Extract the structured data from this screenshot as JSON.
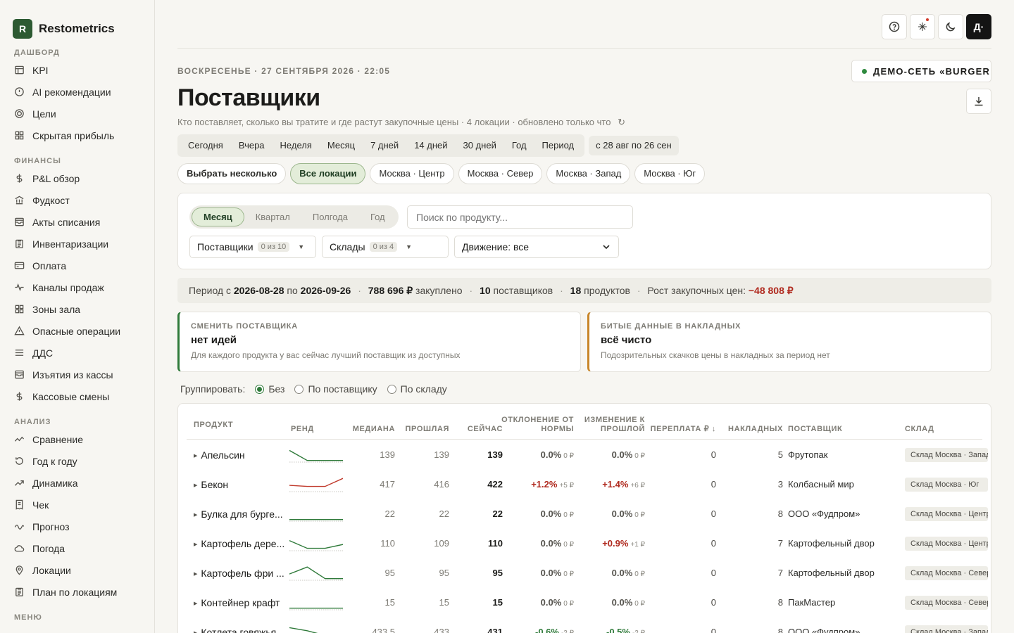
{
  "brand": {
    "logo_letter": "R",
    "name": "Restometrics"
  },
  "sidebar": {
    "sections": [
      {
        "title": "ДАШБОРД",
        "items": [
          {
            "label": "KPI",
            "icon": "layout-icon"
          },
          {
            "label": "AI рекомендации",
            "icon": "alert-circle-icon"
          },
          {
            "label": "Цели",
            "icon": "target-icon"
          },
          {
            "label": "Скрытая прибыль",
            "icon": "grid-icon"
          }
        ]
      },
      {
        "title": "ФИНАНСЫ",
        "items": [
          {
            "label": "P&L обзор",
            "icon": "dollar-icon"
          },
          {
            "label": "Фудкост",
            "icon": "bank-icon"
          },
          {
            "label": "Акты списания",
            "icon": "tray-icon"
          },
          {
            "label": "Инвентаризации",
            "icon": "clipboard-icon"
          },
          {
            "label": "Оплата",
            "icon": "card-icon"
          },
          {
            "label": "Каналы продаж",
            "icon": "pulse-icon"
          },
          {
            "label": "Зоны зала",
            "icon": "grid-icon"
          },
          {
            "label": "Опасные операции",
            "icon": "warning-icon"
          },
          {
            "label": "ДДС",
            "icon": "lines-icon"
          },
          {
            "label": "Изъятия из кассы",
            "icon": "tray-icon"
          },
          {
            "label": "Кассовые смены",
            "icon": "dollar-icon"
          }
        ]
      },
      {
        "title": "АНАЛИЗ",
        "items": [
          {
            "label": "Сравнение",
            "icon": "compare-icon"
          },
          {
            "label": "Год к году",
            "icon": "history-icon"
          },
          {
            "label": "Динамика",
            "icon": "trend-icon"
          },
          {
            "label": "Чек",
            "icon": "receipt-icon"
          },
          {
            "label": "Прогноз",
            "icon": "wave-icon"
          },
          {
            "label": "Погода",
            "icon": "cloud-icon"
          },
          {
            "label": "Локации",
            "icon": "pin-icon"
          },
          {
            "label": "План по локациям",
            "icon": "clipboard-icon"
          }
        ]
      },
      {
        "title": "МЕНЮ",
        "items": []
      }
    ]
  },
  "header": {
    "datetime": "ВОСКРЕСЕНЬЕ · 27 СЕНТЯБРЯ 2026 · 22:05",
    "org": "ДЕМО-СЕТЬ «BURGER...",
    "title": "Поставщики",
    "subtitle": "Кто поставляет, сколько вы тратите и где растут закупочные цены · 4 локации · обновлено только что",
    "refresh_glyph": "↻",
    "avatar_label": "Д·"
  },
  "period_tabs": [
    "Сегодня",
    "Вчера",
    "Неделя",
    "Месяц",
    "7 дней",
    "14 дней",
    "30 дней",
    "Год",
    "Период"
  ],
  "period_range": "с 28 авг по 26 сен",
  "locations": {
    "multi_label": "Выбрать несколько",
    "items": [
      "Все локации",
      "Москва · Центр",
      "Москва · Север",
      "Москва · Запад",
      "Москва · Юг"
    ],
    "active": "Все локации"
  },
  "filters": {
    "granularity": [
      "Месяц",
      "Квартал",
      "Полгода",
      "Год"
    ],
    "granularity_active": "Месяц",
    "search_placeholder": "Поиск по продукту...",
    "suppliers_label": "Поставщики",
    "suppliers_count": "0 из 10",
    "warehouses_label": "Склады",
    "warehouses_count": "0 из 4",
    "movement_label": "Движение: все"
  },
  "summary": {
    "period_prefix": "Период с",
    "date_from": "2026-08-28",
    "date_to_prefix": "по",
    "date_to": "2026-09-26",
    "purchased_value": "788 696 ₽",
    "purchased_label": "закуплено",
    "suppliers_value": "10",
    "suppliers_label": "поставщиков",
    "products_value": "18",
    "products_label": "продуктов",
    "price_growth_label": "Рост закупочных цен:",
    "price_growth_value": "−48 808 ₽"
  },
  "alerts": [
    {
      "title": "СМЕНИТЬ ПОСТАВЩИКА",
      "head": "нет идей",
      "text": "Для каждого продукта у вас сейчас лучший поставщик из доступных",
      "color": "#2f7a3a"
    },
    {
      "title": "БИТЫЕ ДАННЫЕ В НАКЛАДНЫХ",
      "head": "всё чисто",
      "text": "Подозрительных скачков цены в накладных за период нет",
      "color": "#c8862a"
    }
  ],
  "grouping": {
    "label": "Группировать:",
    "options": [
      "Без",
      "По поставщику",
      "По складу"
    ],
    "selected": "Без"
  },
  "table": {
    "columns": {
      "product": "ПРОДУКТ",
      "trend": "РЕНД",
      "median": "МЕДИАНА",
      "previous": "ПРОШЛАЯ",
      "current": "СЕЙЧАС",
      "deviation_l1": "ОТКЛОНЕНИЕ ОТ",
      "deviation_l2": "НОРМЫ",
      "change_l1": "ИЗМЕНЕНИЕ К",
      "change_l2": "ПРОШЛОЙ",
      "overpay": "ПЕРЕПЛАТА ₽ ↓",
      "invoices": "НАКЛАДНЫХ",
      "supplier": "ПОСТАВЩИК",
      "warehouse": "СКЛАД"
    },
    "rows": [
      {
        "product": "Апельсин",
        "median": "139",
        "previous": "139",
        "current": "139",
        "dev_pct": "0.0%",
        "dev_rub": "0 ₽",
        "dev_dir": "zero",
        "chg_pct": "0.0%",
        "chg_rub": "0 ₽",
        "chg_dir": "zero",
        "overpay": "0",
        "invoices": "5",
        "supplier": "Фрутопак",
        "warehouse": "Склад Москва · Запад",
        "trend": [
          0.2,
          0.85,
          0.85,
          0.85
        ],
        "trend_color": "#2f7a3a"
      },
      {
        "product": "Бекон",
        "median": "417",
        "previous": "416",
        "current": "422",
        "dev_pct": "+1.2%",
        "dev_rub": "+5 ₽",
        "dev_dir": "up",
        "chg_pct": "+1.4%",
        "chg_rub": "+6 ₽",
        "chg_dir": "up",
        "overpay": "0",
        "invoices": "3",
        "supplier": "Колбасный мир",
        "warehouse": "Склад Москва · Юг",
        "trend": [
          0.55,
          0.62,
          0.62,
          0.1
        ],
        "trend_color": "#c0392b"
      },
      {
        "product": "Булка для бурге...",
        "median": "22",
        "previous": "22",
        "current": "22",
        "dev_pct": "0.0%",
        "dev_rub": "0 ₽",
        "dev_dir": "zero",
        "chg_pct": "0.0%",
        "chg_rub": "0 ₽",
        "chg_dir": "zero",
        "overpay": "0",
        "invoices": "8",
        "supplier": "ООО «Фудпром»",
        "warehouse": "Склад Москва · Центр",
        "trend": [
          0.85,
          0.85,
          0.85,
          0.85
        ],
        "trend_color": "#2f7a3a"
      },
      {
        "product": "Картофель дере...",
        "median": "110",
        "previous": "109",
        "current": "110",
        "dev_pct": "0.0%",
        "dev_rub": "0 ₽",
        "dev_dir": "zero",
        "chg_pct": "+0.9%",
        "chg_rub": "+1 ₽",
        "chg_dir": "up",
        "overpay": "0",
        "invoices": "7",
        "supplier": "Картофельный двор",
        "warehouse": "Склад Москва · Центр",
        "trend": [
          0.3,
          0.8,
          0.8,
          0.55
        ],
        "trend_color": "#2f7a3a"
      },
      {
        "product": "Картофель фри ...",
        "median": "95",
        "previous": "95",
        "current": "95",
        "dev_pct": "0.0%",
        "dev_rub": "0 ₽",
        "dev_dir": "zero",
        "chg_pct": "0.0%",
        "chg_rub": "0 ₽",
        "chg_dir": "zero",
        "overpay": "0",
        "invoices": "7",
        "supplier": "Картофельный двор",
        "warehouse": "Склад Москва · Север",
        "trend": [
          0.55,
          0.1,
          0.85,
          0.85
        ],
        "trend_color": "#2f7a3a"
      },
      {
        "product": "Контейнер крафт",
        "median": "15",
        "previous": "15",
        "current": "15",
        "dev_pct": "0.0%",
        "dev_rub": "0 ₽",
        "dev_dir": "zero",
        "chg_pct": "0.0%",
        "chg_rub": "0 ₽",
        "chg_dir": "zero",
        "overpay": "0",
        "invoices": "8",
        "supplier": "ПакМастер",
        "warehouse": "Склад Москва · Север",
        "trend": [
          0.85,
          0.85,
          0.85,
          0.85
        ],
        "trend_color": "#2f7a3a"
      },
      {
        "product": "Котлета говяжья...",
        "median": "433.5",
        "previous": "433",
        "current": "431",
        "dev_pct": "-0.6%",
        "dev_rub": "-2 ₽",
        "dev_dir": "down",
        "chg_pct": "-0.5%",
        "chg_rub": "-2 ₽",
        "chg_dir": "down",
        "overpay": "0",
        "invoices": "8",
        "supplier": "ООО «Фудпром»",
        "warehouse": "Склад Москва · Запад",
        "trend": [
          0.2,
          0.4,
          0.7,
          0.8
        ],
        "trend_color": "#2f7a3a"
      }
    ]
  }
}
